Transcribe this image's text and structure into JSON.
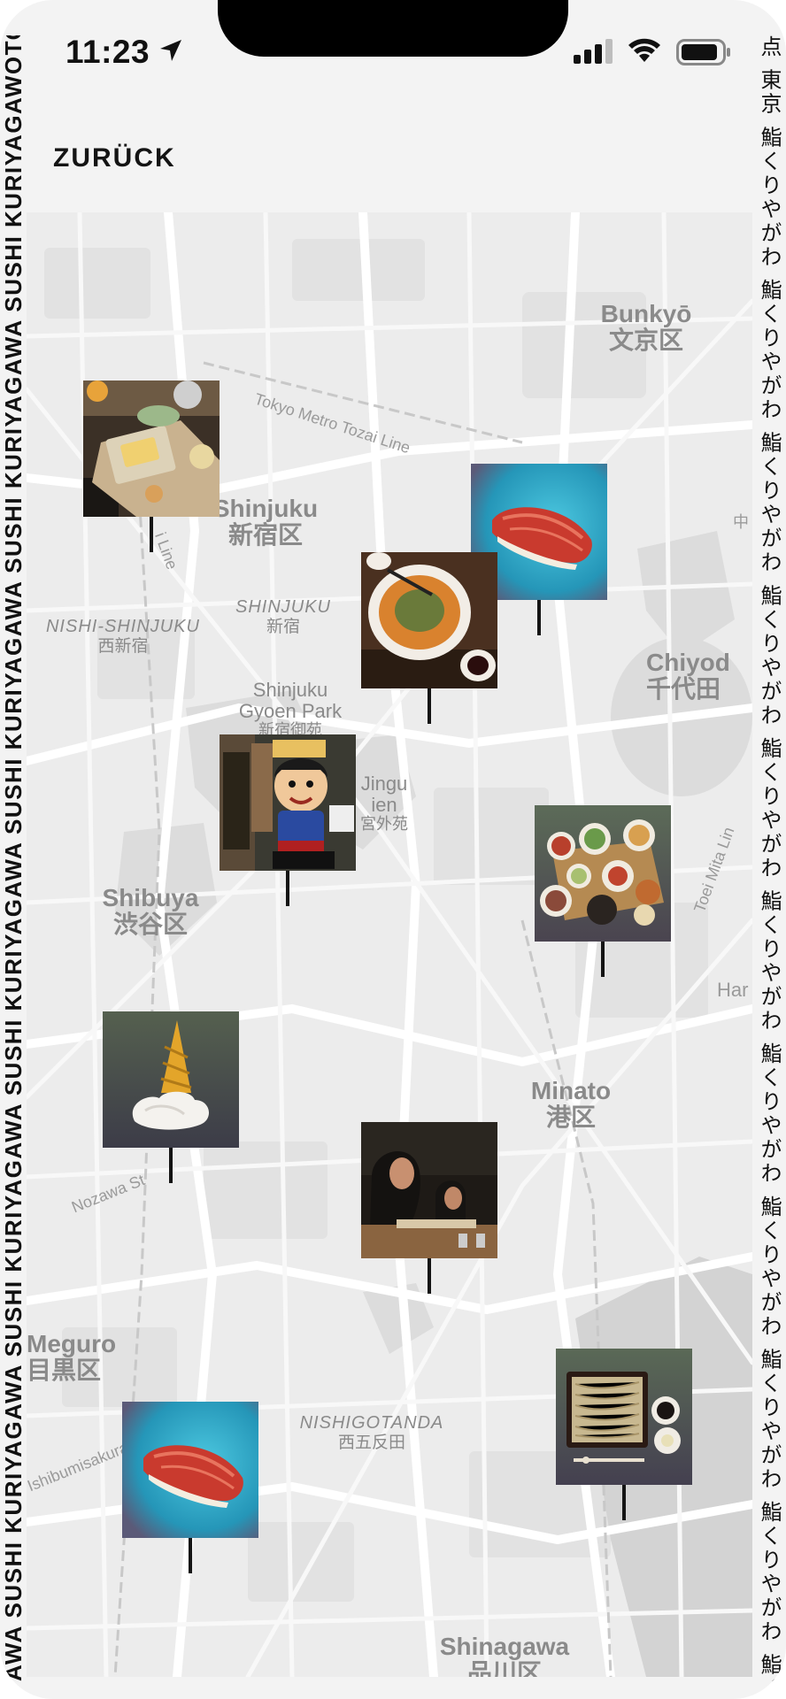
{
  "status_bar": {
    "time": "11:23",
    "icons": [
      "location-arrow-icon",
      "cellular-signal-icon",
      "wifi-icon",
      "battery-icon"
    ]
  },
  "header": {
    "back_label": "ZURÜCK"
  },
  "marquee": {
    "left_text": "AWA SUSHI KURIYAGAWA SUSHI KURIYAGAWA SUSHI KURIYAGAWA SUSHI KURIYAGAWA SUSHI KURIYAGAWA SUSHI KURIYAGAWOTOK",
    "right_text": "点 東京 鮨くりやがわ 鮨くりやがわ 鮨くりやがわ 鮨くりやがわ 鮨くりやがわ 鮨くりやがわ 鮨くりやがわ 鮨くりやがわ 鮨くりやがわ 鮨くりやがわ 鮨くりや"
  },
  "map": {
    "districts": [
      {
        "en": "Bunkyō",
        "jp": "文京区"
      },
      {
        "en": "Shinjuku",
        "jp": "新宿区"
      },
      {
        "en": "SHINJUKU",
        "jp": "新宿"
      },
      {
        "en": "NISHI-SHINJUKU",
        "jp": "西新宿"
      },
      {
        "en": "Shinjuku Gyoen Park",
        "jp": "新宿御苑"
      },
      {
        "en": "Jingu ien",
        "jp": "宮外苑"
      },
      {
        "en": "Chiyod",
        "jp": "千代田"
      },
      {
        "en": "Shibuya",
        "jp": "渋谷区"
      },
      {
        "en": "Minato",
        "jp": "港区"
      },
      {
        "en": "Meguro",
        "jp": "目黒区"
      },
      {
        "en": "NISHIGOTANDA",
        "jp": "西五反田"
      },
      {
        "en": "Shinagawa",
        "jp": "品川区"
      }
    ],
    "streets": [
      "Tokyo Metro Tozai Line",
      "i Line",
      "Toei Mita Lin",
      "Nozawa St",
      "Ishibumisakura St",
      "Har",
      "中"
    ],
    "markers": [
      {
        "subject": "tamagoyaki-dinner-table",
        "bg": "#3b3026"
      },
      {
        "subject": "tuna-nigiri",
        "bg": "#2b9fc2"
      },
      {
        "subject": "ramen-bowl",
        "bg": "#4a3020"
      },
      {
        "subject": "restaurant-entrance-mascot",
        "bg": "#3a3a32"
      },
      {
        "subject": "bento-tray",
        "bg": "#5c6b58"
      },
      {
        "subject": "soft-serve-ice-cream",
        "bg": "#55604f"
      },
      {
        "subject": "diners-at-counter",
        "bg": "#1e1a16"
      },
      {
        "subject": "zaru-soba",
        "bg": "#5a6956"
      },
      {
        "subject": "tuna-nigiri",
        "bg": "#2b9fc2"
      }
    ]
  }
}
